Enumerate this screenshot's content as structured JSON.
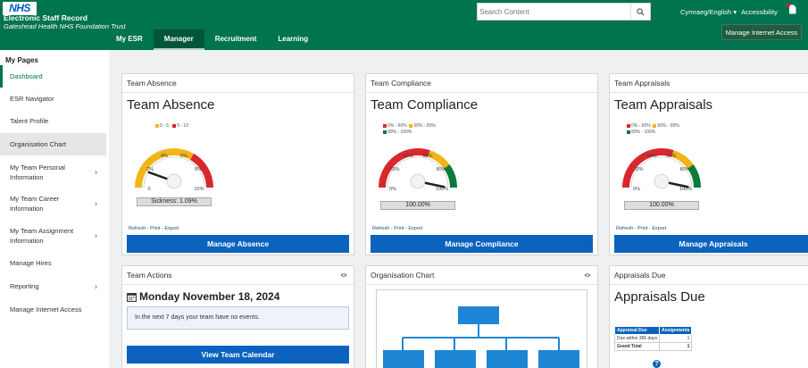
{
  "header": {
    "logo": "NHS",
    "app_title": "Electronic Staff Record",
    "trust": "Gateshead Health NHS Foundation Trust",
    "search_placeholder": "Search Content",
    "language": "Cymraeg/English ▾",
    "accessibility": "Accessibility",
    "manage_internet_access": "Manage Internet Access"
  },
  "nav": {
    "tabs": [
      {
        "label": "My ESR",
        "active": false
      },
      {
        "label": "Manager",
        "active": true
      },
      {
        "label": "Recruitment",
        "active": false
      },
      {
        "label": "Learning",
        "active": false
      }
    ]
  },
  "sidebar": {
    "title": "My Pages",
    "items": [
      {
        "label": "Dashboard",
        "active": true,
        "chevron": false
      },
      {
        "label": "ESR Navigator",
        "chevron": false
      },
      {
        "label": "Talent Profile",
        "chevron": false
      },
      {
        "label": "Organisation Chart",
        "highlighted": true,
        "chevron": false
      },
      {
        "label": "My Team Personal Information",
        "chevron": true
      },
      {
        "label": "My Team Career Information",
        "chevron": true
      },
      {
        "label": "My Team Assignment Information",
        "chevron": true
      },
      {
        "label": "Manage Hires",
        "chevron": false
      },
      {
        "label": "Reporting",
        "chevron": true
      },
      {
        "label": "Manage Internet Access",
        "chevron": false
      }
    ]
  },
  "colors": {
    "header_green": "#00734f",
    "primary_blue": "#0b63bd",
    "gauge_red": "#d9272e",
    "gauge_yellow": "#f2b518",
    "gauge_green": "#0a7a3d"
  },
  "cards": {
    "absence": {
      "header": "Team Absence",
      "title": "Team Absence",
      "legend": [
        "0 - 5",
        "5 - 10"
      ],
      "ticks": [
        "0",
        "2%",
        "4%",
        "6%",
        "8%",
        "10%"
      ],
      "value_label": "Sickness: 1.09%",
      "value_fraction": 0.109,
      "links": "Refresh  - Print  - Export",
      "button": "Manage Absence"
    },
    "compliance": {
      "header": "Team Compliance",
      "title": "Team Compliance",
      "legend": [
        "0% - 60%",
        "60% - 80%",
        "80% - 100%"
      ],
      "ticks": [
        "0%",
        "20%",
        "40%",
        "60%",
        "80%",
        "100%"
      ],
      "value_label": "100.00%",
      "value_fraction": 1.0,
      "links": "Refresh  - Print  - Export",
      "button": "Manage Compliance"
    },
    "appraisals": {
      "header": "Team Appraisals",
      "title": "Team Appraisals",
      "legend": [
        "0% - 60%",
        "60% - 80%",
        "80% - 100%"
      ],
      "ticks": [
        "0%",
        "20%",
        "40%",
        "60%",
        "80%",
        "100%"
      ],
      "value_label": "100.00%",
      "value_fraction": 1.0,
      "links": "Refresh  - Print  - Export",
      "button": "Manage Appraisals"
    },
    "actions": {
      "header": "Team Actions",
      "date": "Monday November 18, 2024",
      "info": "In the next 7 days your team have no events.",
      "button": "View Team Calendar"
    },
    "org_chart": {
      "header": "Organisation Chart"
    },
    "appraisals_due": {
      "header": "Appraisals Due",
      "title": "Appraisals Due",
      "table": {
        "headers": [
          "Appraisal Due",
          "Assignments"
        ],
        "rows": [
          [
            "Due within 365 days",
            "1"
          ]
        ],
        "total": [
          "Grand Total",
          "1"
        ]
      },
      "help": "?"
    }
  }
}
